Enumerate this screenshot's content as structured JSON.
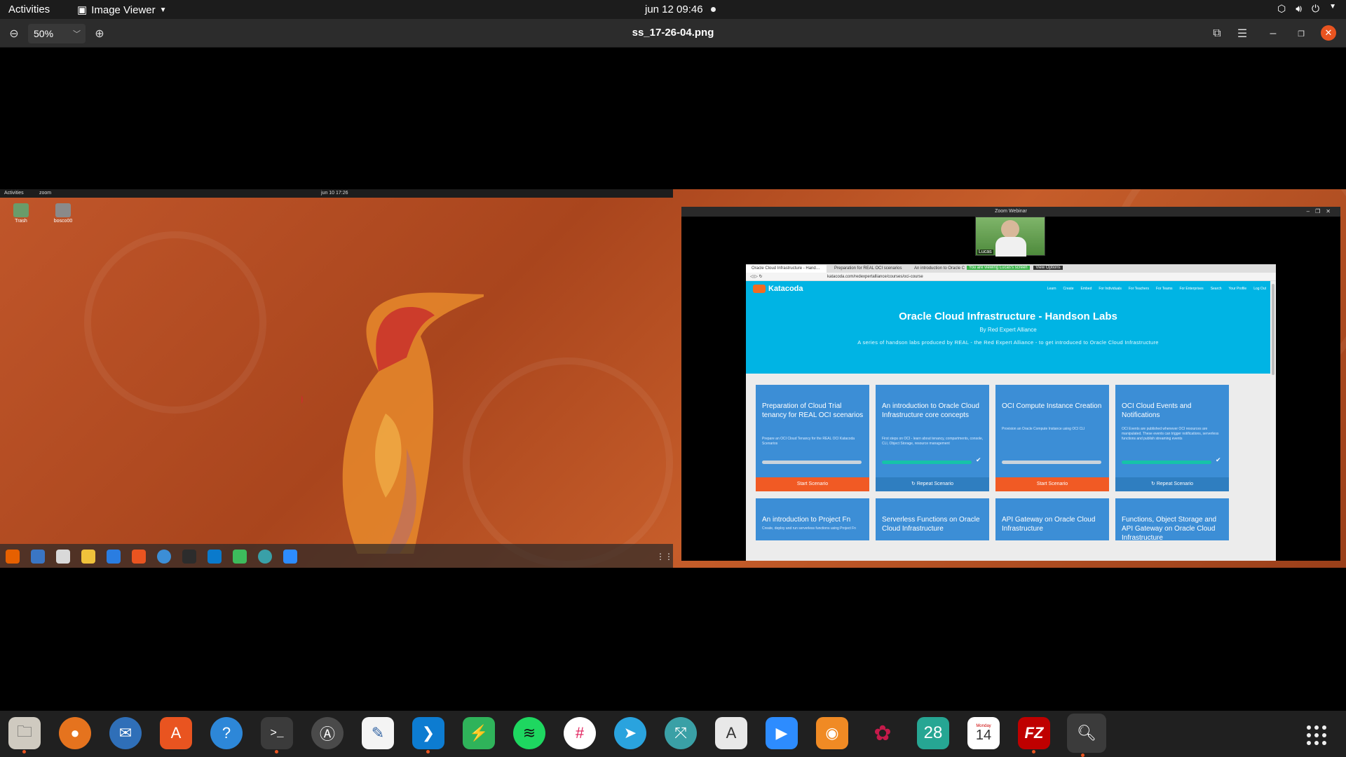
{
  "topbar": {
    "activities": "Activities",
    "app_menu": "Image Viewer",
    "clock": "jun 12  09:46"
  },
  "viewer": {
    "zoom_level": "50%",
    "filename": "ss_17-26-04.png"
  },
  "screenshot": {
    "left_screen": {
      "activities": "Activities",
      "app": "zoom",
      "clock": "jun 10  17:26",
      "desktop_icons": [
        "Trash",
        "bosco00"
      ]
    },
    "zoom_window": {
      "title": "Zoom Webinar",
      "participant": "Lucas"
    },
    "browser": {
      "tabs": [
        "Oracle Cloud Infrastructure - Hand…",
        "Preparation for REAL OCI scenarios",
        "An introduction to Oracle Cloud…"
      ],
      "share_status": "You are viewing Lucas's screen",
      "view_options": "View Options",
      "url": "katacoda.com/redexpertalliance/courses/oci-course",
      "site": {
        "logo": "Katacoda",
        "nav": [
          "Learn",
          "Create",
          "Embed",
          "For Individuals",
          "For Teachers",
          "For Teams",
          "For Enterprises",
          "Search",
          "Your Profile",
          "Log Out"
        ],
        "title": "Oracle Cloud Infrastructure - Handson Labs",
        "byline": "By Red Expert Alliance",
        "description": "A series of handson labs produced by REAL - the Red Expert Alliance - to get introduced to Oracle Cloud Infrastructure"
      },
      "cards_row1": [
        {
          "title": "Preparation of Cloud Trial tenancy for REAL OCI scenarios",
          "desc": "Prepare an OCI Cloud Tenancy for the REAL OCI Katacoda Scenarios",
          "action": "Start Scenario",
          "done": false
        },
        {
          "title": "An introduction to Oracle Cloud Infrastructure core concepts",
          "desc": "First steps on OCI - learn about tenancy, compartments, console, CLI, Object Storage, resource management",
          "action": "Repeat Scenario",
          "done": true
        },
        {
          "title": "OCI Compute Instance Creation",
          "desc": "Provision an Oracle Compute Instance using OCI CLI",
          "action": "Start Scenario",
          "done": false
        },
        {
          "title": "OCI Cloud Events and Notifications",
          "desc": "OCI Events are published whenever OCI resources are manipulated. These events can trigger notifications, serverless functions and publish streaming events",
          "action": "Repeat Scenario",
          "done": true
        }
      ],
      "cards_row2": [
        {
          "title": "An introduction to Project Fn",
          "desc": "Create, deploy and run serverless functions using Project Fn"
        },
        {
          "title": "Serverless Functions on Oracle Cloud Infrastructure"
        },
        {
          "title": "API Gateway on Oracle Cloud Infrastructure"
        },
        {
          "title": "Functions, Object Storage and API Gateway on Oracle Cloud Infrastructure"
        }
      ]
    }
  },
  "dock": {
    "calendar_month": "Monday",
    "calendar_day": "14",
    "date_badge": "28"
  },
  "colors": {
    "accent": "#e95420",
    "katacoda_blue": "#00b4e4",
    "card_blue": "#3c8ed6",
    "start_orange": "#f15a24"
  }
}
